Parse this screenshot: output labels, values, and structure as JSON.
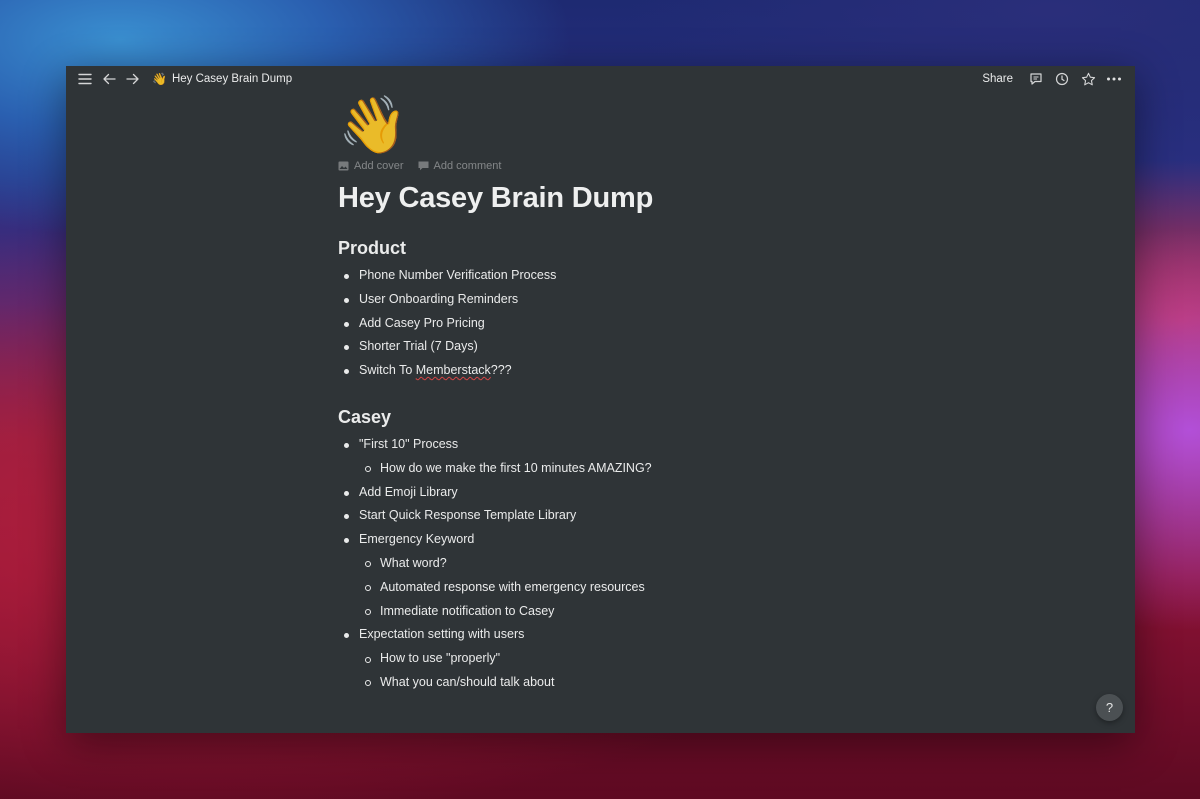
{
  "breadcrumb": {
    "emoji": "👋",
    "title": "Hey Casey Brain Dump"
  },
  "topbar": {
    "share_label": "Share",
    "icons": [
      "menu-icon",
      "back-arrow-icon",
      "forward-arrow-icon",
      "comment-icon",
      "history-clock-icon",
      "favorite-star-icon",
      "more-dots-icon"
    ]
  },
  "page": {
    "emoji": "👋",
    "add_cover": "Add cover",
    "add_comment": "Add comment",
    "title": "Hey Casey Brain Dump"
  },
  "sections": [
    {
      "heading": "Product",
      "items": [
        "Phone Number Verification Process",
        "User Onboarding Reminders",
        "Add Casey Pro Pricing",
        "Shorter Trial (7 Days)",
        {
          "prefix": "Switch To ",
          "misspelled": "Memberstack",
          "suffix": "???"
        }
      ]
    },
    {
      "heading": "Casey",
      "items": [
        {
          "text": "\"First 10\" Process",
          "children": [
            "How do we make the first 10 minutes AMAZING?"
          ]
        },
        {
          "text": "Add Emoji Library"
        },
        {
          "text": "Start Quick Response Template Library"
        },
        {
          "text": "Emergency Keyword",
          "children": [
            "What word?",
            "Automated response with emergency resources",
            "Immediate notification to Casey"
          ]
        },
        {
          "text": "Expectation setting with users",
          "children": [
            "How to use \"properly\"",
            "What you can/should talk about"
          ]
        }
      ]
    }
  ],
  "help_label": "?",
  "colors": {
    "window_bg": "#2f3437",
    "text": "#e6e7e7",
    "muted": "#8a8d8f",
    "spellcheck": "#d64545"
  }
}
